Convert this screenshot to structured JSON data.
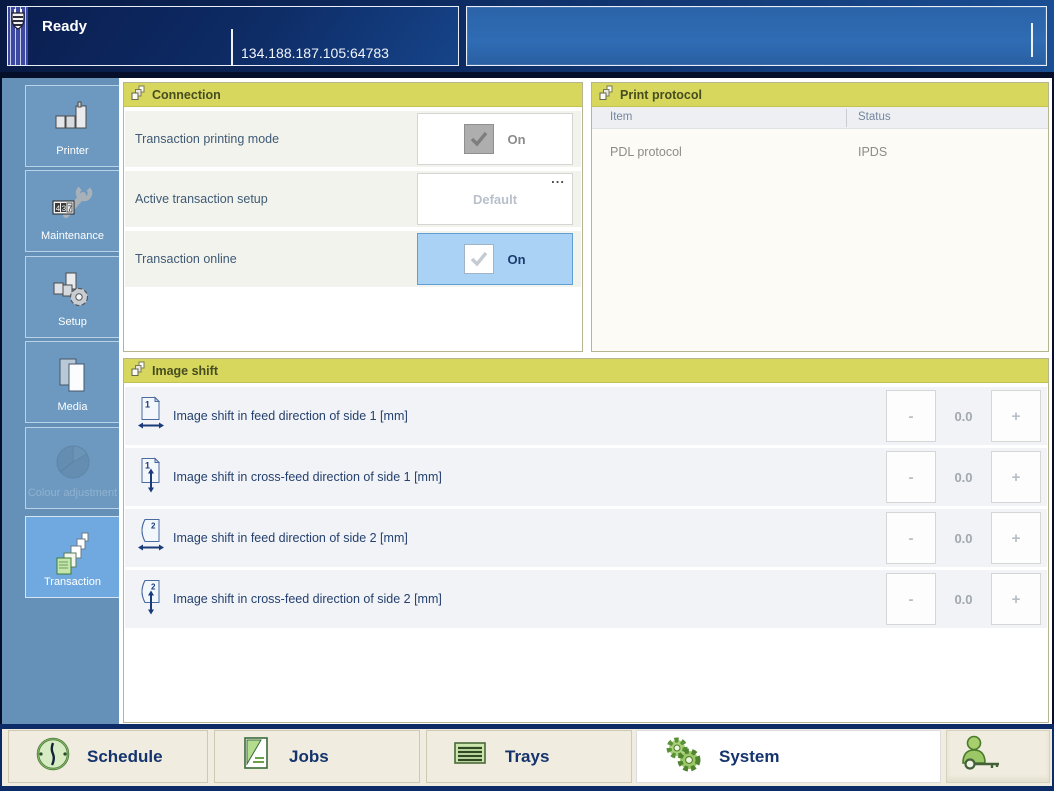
{
  "topbar": {
    "status": "Ready",
    "address": "134.188.187.105:64783"
  },
  "sidebar": {
    "items": [
      {
        "label": "Printer",
        "icon": "printer-icon",
        "state": "normal"
      },
      {
        "label": "Maintenance",
        "icon": "maintenance-icon",
        "state": "normal"
      },
      {
        "label": "Setup",
        "icon": "setup-icon",
        "state": "normal"
      },
      {
        "label": "Media",
        "icon": "media-icon",
        "state": "normal"
      },
      {
        "label": "Colour adjustment",
        "icon": "colour-adjustment-icon",
        "state": "disabled"
      },
      {
        "label": "Transaction",
        "icon": "transaction-icon",
        "state": "selected"
      }
    ]
  },
  "connection": {
    "title": "Connection",
    "rows": [
      {
        "label": "Transaction printing mode",
        "control": "checkbox",
        "value": "On",
        "state": "checked-disabled"
      },
      {
        "label": "Active transaction setup",
        "control": "picker",
        "value": "Default",
        "more": "...",
        "state": "disabled"
      },
      {
        "label": "Transaction online",
        "control": "checkbox",
        "value": "On",
        "state": "checked-selected"
      }
    ]
  },
  "protocol": {
    "title": "Print protocol",
    "columns": {
      "item": "Item",
      "status": "Status"
    },
    "rows": [
      {
        "item": "PDL protocol",
        "status": "IPDS"
      }
    ]
  },
  "imageshift": {
    "title": "Image shift",
    "minus": "-",
    "plus": "+",
    "rows": [
      {
        "label": "Image shift in feed direction of side 1 [mm]",
        "icon": "shift-feed-side1-icon",
        "value": "0.0"
      },
      {
        "label": "Image shift in cross-feed direction of side 1 [mm]",
        "icon": "shift-crossfeed-side1-icon",
        "value": "0.0"
      },
      {
        "label": "Image shift in feed direction of side 2 [mm]",
        "icon": "shift-feed-side2-icon",
        "value": "0.0"
      },
      {
        "label": "Image shift in cross-feed direction of side 2 [mm]",
        "icon": "shift-crossfeed-side2-icon",
        "value": "0.0"
      }
    ]
  },
  "bottombar": {
    "tabs": [
      {
        "label": "Schedule",
        "icon": "schedule-clock-icon",
        "state": "normal"
      },
      {
        "label": "Jobs",
        "icon": "jobs-document-icon",
        "state": "normal"
      },
      {
        "label": "Trays",
        "icon": "trays-icon",
        "state": "normal"
      },
      {
        "label": "System",
        "icon": "system-gears-icon",
        "state": "selected"
      },
      {
        "label": "",
        "icon": "operator-key-icon",
        "state": "normal"
      }
    ]
  },
  "colors": {
    "panel_header": "#d6d75c",
    "selected_control": "#a9d2f4",
    "sidebar": "#6590b7",
    "sidebar_selected": "#6fa9e0",
    "topbar_navy": "#0d2a60",
    "bottombar_cream": "#f0ecdf",
    "navy_text": "#15346d"
  }
}
